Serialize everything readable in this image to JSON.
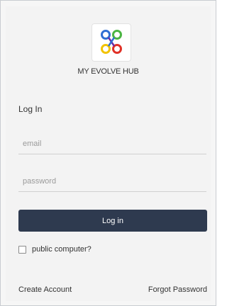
{
  "app": {
    "name": "MY EVOLVE HUB"
  },
  "colors": {
    "primary_button": "#2e3a4f",
    "logo_blue": "#2f6fd3",
    "logo_green": "#4bb543",
    "logo_yellow": "#f2c300",
    "logo_red": "#e03127"
  },
  "icons": {
    "logo": "colored-rings-logo-icon"
  },
  "form": {
    "title": "Log In",
    "email_placeholder": "email",
    "password_placeholder": "password",
    "submit_label": "Log in",
    "public_computer_label": "public computer?"
  },
  "links": {
    "create_account": "Create Account",
    "forgot_password": "Forgot Password"
  }
}
